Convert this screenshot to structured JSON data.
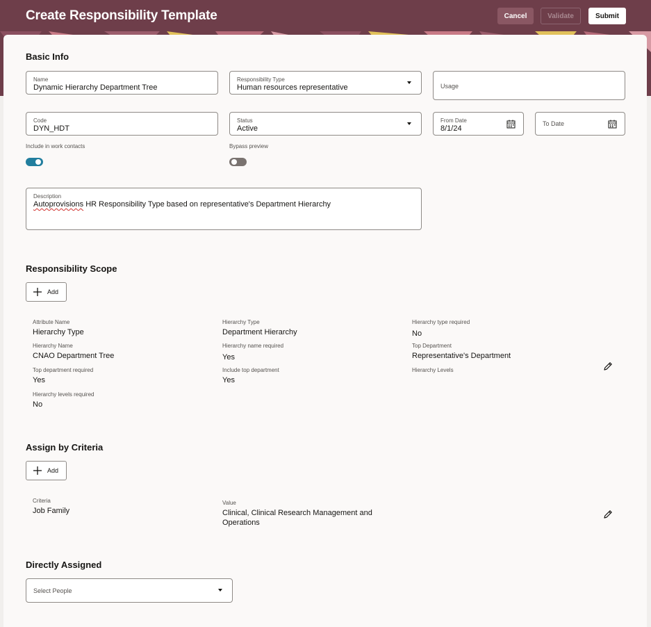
{
  "header": {
    "title": "Create Responsibility Template",
    "cancel_label": "Cancel",
    "validate_label": "Validate",
    "submit_label": "Submit"
  },
  "basic_info": {
    "heading": "Basic Info",
    "name": {
      "label": "Name",
      "value": "Dynamic Hierarchy Department Tree"
    },
    "responsibility_type": {
      "label": "Responsibility Type",
      "value": "Human resources representative"
    },
    "usage": {
      "label": "Usage"
    },
    "code": {
      "label": "Code",
      "value": "DYN_HDT"
    },
    "status": {
      "label": "Status",
      "value": "Active"
    },
    "from_date": {
      "label": "From Date",
      "value": "8/1/24"
    },
    "to_date": {
      "label": "To Date"
    },
    "include_work_contacts": {
      "label": "Include in work contacts",
      "on": true
    },
    "bypass_preview": {
      "label": "Bypass preview",
      "on": false
    },
    "description": {
      "label": "Description",
      "value_first_word": "Autoprovisions",
      "value_rest": " HR Responsibility Type based on representative's Department Hierarchy"
    }
  },
  "responsibility_scope": {
    "heading": "Responsibility Scope",
    "add_label": "Add",
    "attribute_name": {
      "label": "Attribute Name",
      "value": "Hierarchy Type"
    },
    "hierarchy_type": {
      "label": "Hierarchy Type",
      "value": "Department Hierarchy"
    },
    "hierarchy_type_required": {
      "label": "Hierarchy type required",
      "value": "No"
    },
    "hierarchy_name": {
      "label": "Hierarchy Name",
      "value": "CNAO Department Tree"
    },
    "hierarchy_name_required": {
      "label": "Hierarchy name required",
      "value": "Yes"
    },
    "top_department": {
      "label": "Top Department",
      "value": "Representative's Department"
    },
    "top_department_required": {
      "label": "Top department required",
      "value": "Yes"
    },
    "include_top_department": {
      "label": "Include top department",
      "value": "Yes"
    },
    "hierarchy_levels": {
      "label": "Hierarchy Levels",
      "value": ""
    },
    "hierarchy_levels_required": {
      "label": "Hierarchy levels required",
      "value": "No"
    }
  },
  "assign_by_criteria": {
    "heading": "Assign by Criteria",
    "add_label": "Add",
    "criteria": {
      "label": "Criteria",
      "value": "Job Family"
    },
    "value": {
      "label": "Value",
      "line1": "Clinical, Clinical Research Management and",
      "line2": "Operations"
    }
  },
  "directly_assigned": {
    "heading": "Directly Assigned",
    "select_people_placeholder": "Select People"
  },
  "icons": {
    "dropdown": "chevron-down-icon",
    "calendar": "calendar-icon",
    "add": "plus-icon",
    "edit": "pencil-icon"
  },
  "colors": {
    "header_bg": "#6e3e4a",
    "toggle_on": "#227e9e",
    "toggle_off": "#7a7370",
    "card_bg": "#fbf9f8"
  }
}
